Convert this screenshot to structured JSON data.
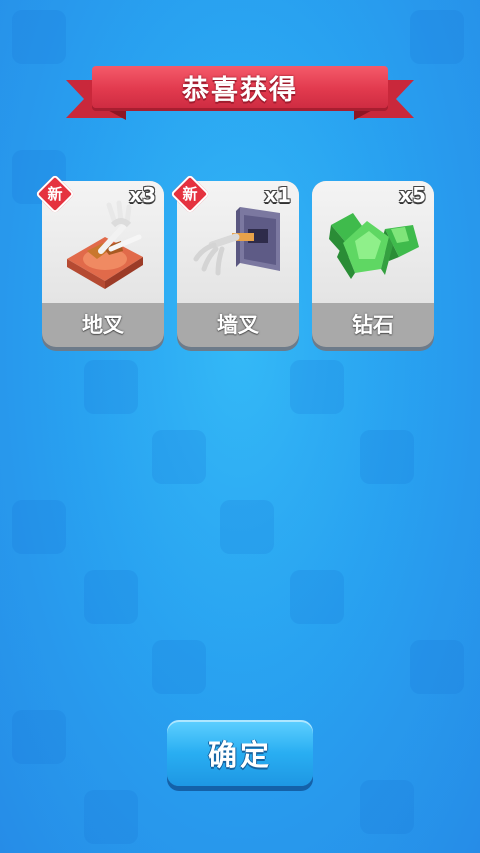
{
  "title": "恭喜获得",
  "rewards": [
    {
      "name": "地叉",
      "quantity": "x3",
      "badge": "新",
      "icon": "floor-fork-icon"
    },
    {
      "name": "墙叉",
      "quantity": "x1",
      "badge": "新",
      "icon": "wall-fork-icon"
    },
    {
      "name": "钻石",
      "quantity": "x5",
      "badge": "",
      "icon": "diamond-gem-icon"
    }
  ],
  "confirm_label": "确定",
  "colors": {
    "background": "#1e9ef0",
    "ribbon": "#e23a4e",
    "badge": "#e5323f",
    "button": "#29aef2"
  }
}
